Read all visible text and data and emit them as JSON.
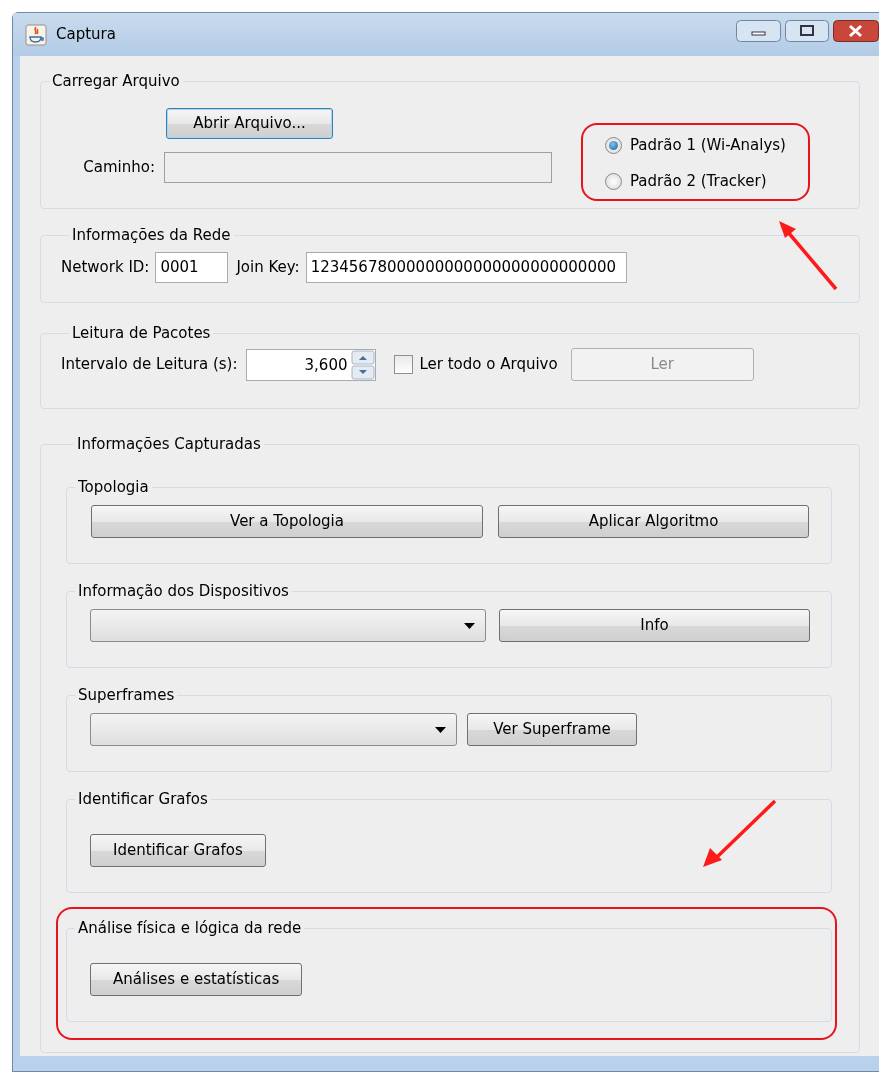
{
  "window": {
    "title": "Captura"
  },
  "load_file": {
    "title": "Carregar Arquivo",
    "open_button": "Abrir Arquivo...",
    "path_label": "Caminho:",
    "format_options": [
      {
        "label": "Padrão 1 (Wi-Analys)",
        "selected": true
      },
      {
        "label": "Padrão 2 (Tracker)",
        "selected": false
      }
    ]
  },
  "network_info": {
    "title": "Informações da Rede",
    "network_id_label": "Network ID:",
    "network_id": "0001",
    "join_key_label": "Join Key:",
    "join_key": "12345678000000000000000000000000"
  },
  "packet_reading": {
    "title": "Leitura de Pacotes",
    "interval_label": "Intervalo de Leitura (s):",
    "interval": "3,600",
    "read_all": {
      "label": "Ler todo o Arquivo",
      "checked": false
    },
    "read_button": {
      "label": "Ler",
      "disabled": true
    }
  },
  "captured_info": {
    "title": "Informações Capturadas",
    "groups": [
      {
        "title": "Topologia",
        "kind": "buttons",
        "buttons": [
          "Ver a Topologia",
          "Aplicar Algoritmo"
        ]
      },
      {
        "title": "Informação dos Dispositivos",
        "kind": "combo",
        "button": "Info"
      },
      {
        "title": "Superframes",
        "kind": "combo",
        "button": "Ver Superframe"
      },
      {
        "title": "Identificar Grafos",
        "kind": "single",
        "button": "Identificar Grafos"
      },
      {
        "title": "Análise física e lógica da rede",
        "kind": "single",
        "button": "Análises e estatísticas",
        "highlighted": true
      }
    ]
  }
}
